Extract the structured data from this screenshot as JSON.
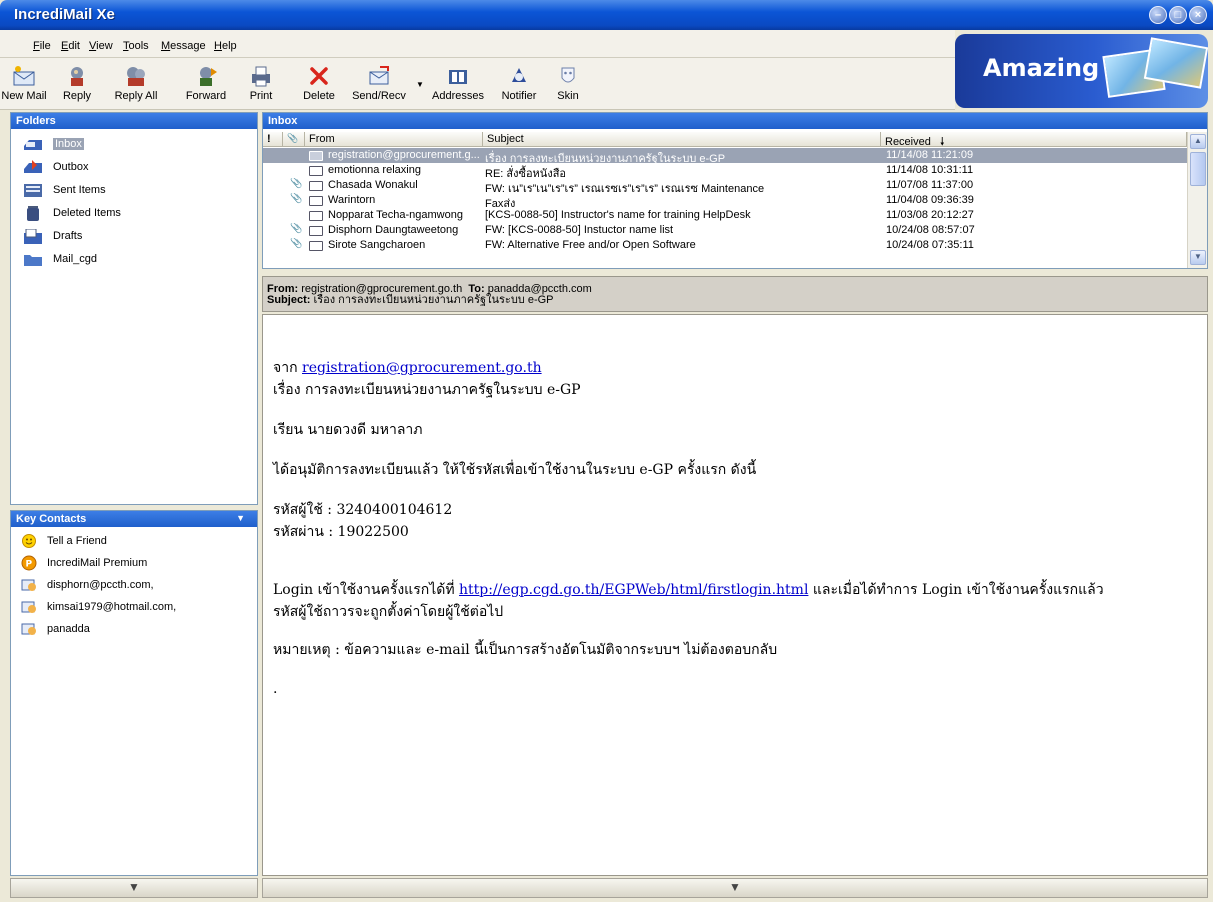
{
  "window": {
    "title": "IncrediMail Xe"
  },
  "menu": [
    "File",
    "Edit",
    "View",
    "Tools",
    "Message",
    "Help"
  ],
  "toolbar": [
    {
      "label": "New Mail",
      "icon": "new-mail-icon"
    },
    {
      "label": "Reply",
      "icon": "reply-icon"
    },
    {
      "label": "Reply All",
      "icon": "reply-all-icon"
    },
    {
      "label": "Forward",
      "icon": "forward-icon"
    },
    {
      "label": "Print",
      "icon": "print-icon"
    },
    {
      "label": "Delete",
      "icon": "delete-icon"
    },
    {
      "label": "Send/Recv",
      "icon": "send-receive-icon"
    },
    {
      "label": "Addresses",
      "icon": "address-book-icon"
    },
    {
      "label": "Notifier",
      "icon": "notifier-icon"
    },
    {
      "label": "Skin",
      "icon": "skin-icon"
    }
  ],
  "banner": {
    "text": "Amazing"
  },
  "folders": {
    "title": "Folders",
    "items": [
      {
        "label": "Inbox",
        "icon": "inbox-icon",
        "selected": true
      },
      {
        "label": "Outbox",
        "icon": "outbox-icon"
      },
      {
        "label": "Sent Items",
        "icon": "sent-items-icon"
      },
      {
        "label": "Deleted Items",
        "icon": "trash-icon"
      },
      {
        "label": "Drafts",
        "icon": "drafts-icon"
      },
      {
        "label": "Mail_cgd",
        "icon": "folder-icon"
      }
    ]
  },
  "contacts": {
    "title": "Key Contacts",
    "items": [
      {
        "label": "Tell a Friend",
        "icon": "smiley-icon"
      },
      {
        "label": "IncrediMail Premium",
        "icon": "premium-icon"
      },
      {
        "label": "disphorn@pccth.com,",
        "icon": "contact-card-icon"
      },
      {
        "label": "kimsai1979@hotmail.com,",
        "icon": "contact-card-icon"
      },
      {
        "label": "panadda",
        "icon": "contact-card-icon"
      }
    ]
  },
  "inbox": {
    "title": "Inbox",
    "columns": {
      "flag": "!",
      "attach": "📎",
      "from": "From",
      "subject": "Subject",
      "received": "Received"
    },
    "sort_indicator": "🠗",
    "messages": [
      {
        "attach": false,
        "from": "registration@gprocurement.g...",
        "subject": "เรื่อง การลงทะเบียนหน่วยงานภาครัฐในระบบ e-GP",
        "received": "11/14/08 11:21:09",
        "selected": true
      },
      {
        "attach": false,
        "from": "emotionna relaxing",
        "subject": "RE: สั่งซื้อหนังสือ",
        "received": "11/14/08 10:31:11"
      },
      {
        "attach": true,
        "from": "Chasada Wonakul",
        "subject": "FW: เน”เร”เน”เร”เร” เรณเรซเร”เร”เร” เรณเรซ Maintenance",
        "received": "11/07/08 11:37:00"
      },
      {
        "attach": true,
        "from": "Warintorn",
        "subject": "Faxส่ง",
        "received": "11/04/08 09:36:39"
      },
      {
        "attach": false,
        "from": "Nopparat Techa-ngamwong",
        "subject": "[KCS-0088-50] Instructor's name for training HelpDesk",
        "received": "11/03/08 20:12:27"
      },
      {
        "attach": true,
        "from": "Disphorn Daungtaweetong",
        "subject": "FW: [KCS-0088-50] Instuctor name list",
        "received": "10/24/08 08:57:07"
      },
      {
        "attach": true,
        "from": "Sirote Sangcharoen",
        "subject": "FW: Alternative Free and/or Open Software",
        "received": "10/24/08 07:35:11"
      }
    ]
  },
  "preview": {
    "from_label": "From:",
    "from": "registration@gprocurement.go.th",
    "to_label": "To:",
    "to": "panadda@pccth.com",
    "subject_label": "Subject:",
    "subject": "เรื่อง การลงทะเบียนหน่วยงานภาครัฐในระบบ e-GP"
  },
  "body": {
    "from_prefix": "จาก",
    "from_link": "registration@gprocurement.go.th",
    "subject_line": "เรื่อง การลงทะเบียนหน่วยงานภาครัฐในระบบ e-GP",
    "greeting": "เรียน นายดวงดี มหาลาภ",
    "approval": "ได้อนุมัติการลงทะเบียนแล้ว ให้ใช้รหัสเพื่อเข้าใช้งานในระบบ e-GP ครั้งแรก ดังนี้",
    "user_id": "รหัสผู้ใช้ : 3240400104612",
    "password": "รหัสผ่าน : 19022500",
    "login_prefix": "Login เข้าใช้งานครั้งแรกได้ที่",
    "login_link": "http://egp.cgd.go.th/EGPWeb/html/firstlogin.html",
    "login_suffix": "และเมื่อได้ทำการ Login เข้าใช้งานครั้งแรกแล้ว",
    "login_line2": "รหัสผู้ใช้ถาวรจะถูกตั้งค่าโดยผู้ใช้ต่อไป",
    "note": "หมายเหตุ : ข้อความและ e-mail นี้เป็นการสร้างอัตโนมัติจากระบบฯ ไม่ต้องตอบกลับ",
    "trailing": "."
  },
  "colors": {
    "title_bar": "#0b55d6",
    "pane_header": "#2a6ad8",
    "selection": "#9aa3b4",
    "link": "#0000cc"
  }
}
